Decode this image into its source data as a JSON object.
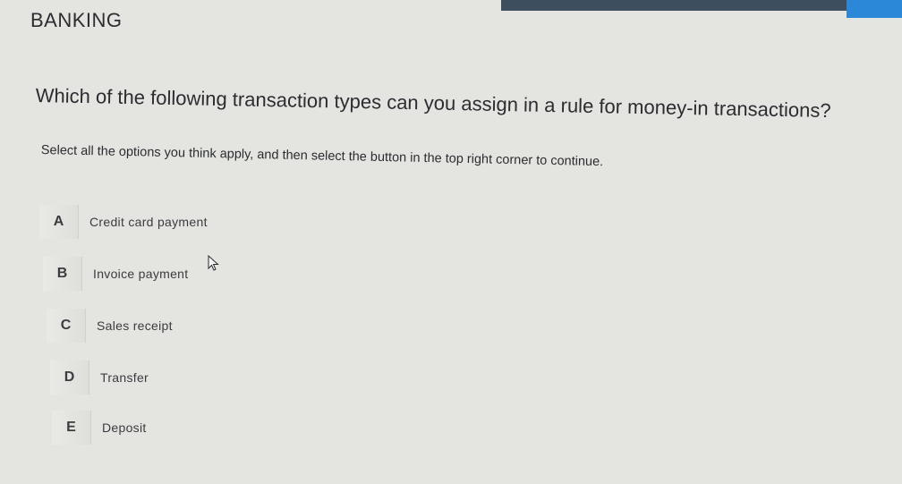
{
  "header": {
    "category": "BANKING"
  },
  "question": {
    "text": "Which of the following transaction types can you assign in a rule for money-in transactions?",
    "instruction": "Select all the options you think apply, and then select the button in the top right corner to continue."
  },
  "options": [
    {
      "letter": "A",
      "label": "Credit card payment"
    },
    {
      "letter": "B",
      "label": "Invoice payment"
    },
    {
      "letter": "C",
      "label": "Sales receipt"
    },
    {
      "letter": "D",
      "label": "Transfer"
    },
    {
      "letter": "E",
      "label": "Deposit"
    }
  ],
  "colors": {
    "background": "#e4e5e1",
    "top_bar": "#3d4f5f",
    "accent": "#2b88d8"
  },
  "icons": {
    "pointer": "mouse-pointer-icon"
  }
}
